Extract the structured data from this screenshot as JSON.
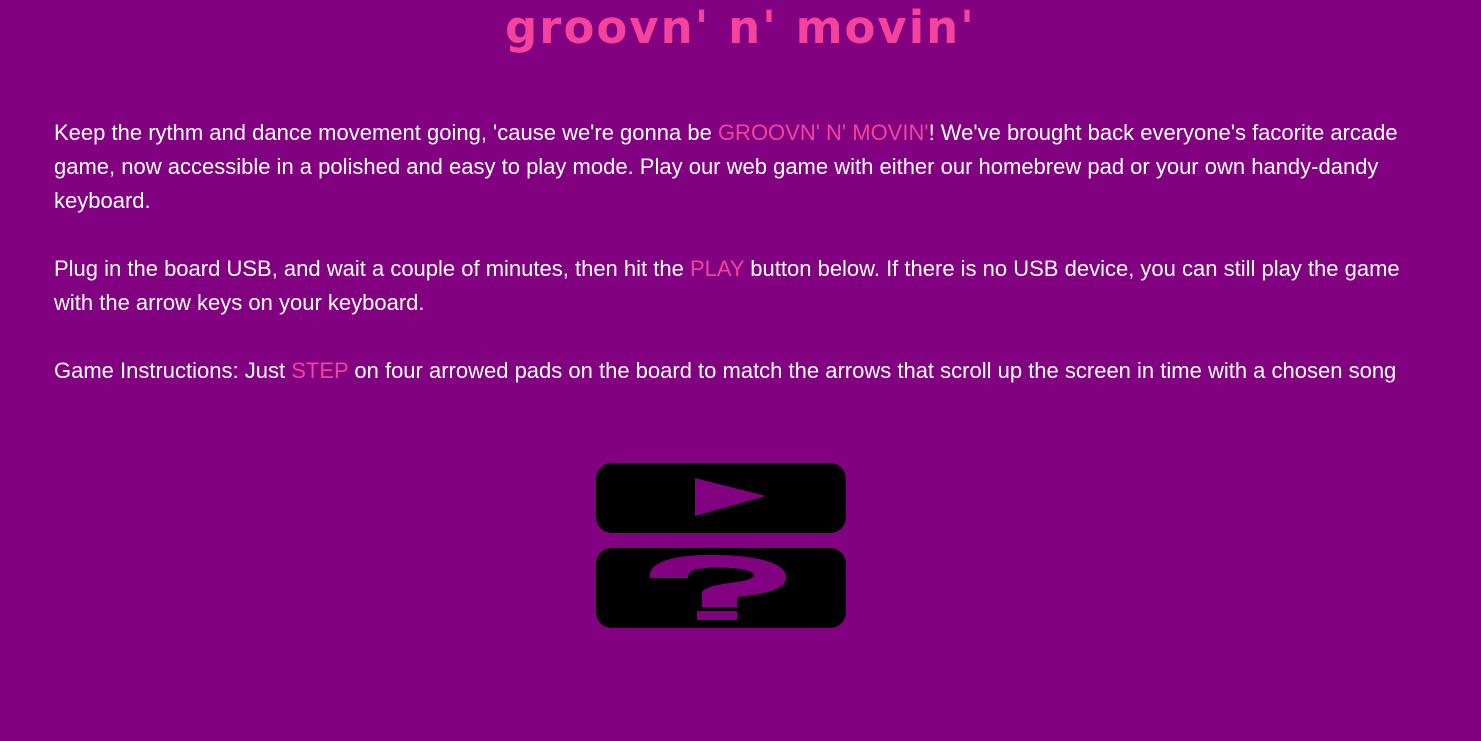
{
  "header": {
    "title": "groovn' n' movin'"
  },
  "intro": {
    "text_before": "Keep the rythm and dance movement going, 'cause we're gonna be ",
    "highlight": "GROOVN' N' MOVIN'",
    "text_after": "! We've brought back everyone's facorite arcade game, now accessible in a polished and easy to play mode. Play our web game with either our homebrew pad or your own handy-dandy keyboard."
  },
  "usb": {
    "text_before": "Plug in the board USB, and wait a couple of minutes, then hit the ",
    "highlight": "PLAY",
    "text_after": " button below. If there is no USB device, you can still play the game with the arrow keys on your keyboard."
  },
  "instructions": {
    "text_before": "Game Instructions: Just ",
    "highlight": "STEP",
    "text_after": " on four arrowed pads on the board to match the arrows that scroll up the screen in time with a chosen song"
  },
  "buttons": {
    "play_icon": "play-triangle-icon",
    "help_icon": "question-mark-icon"
  },
  "colors": {
    "background": "#820180",
    "accent": "#f4439c",
    "text": "#ffffff",
    "button": "#000000"
  }
}
